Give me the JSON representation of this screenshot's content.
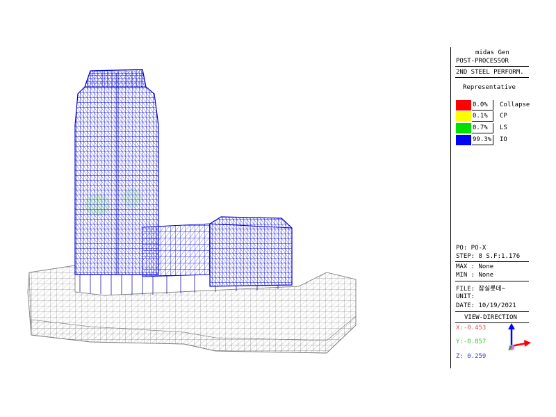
{
  "legend_panel": {
    "app_name": "midas Gen",
    "module": "POST-PROCESSOR",
    "result_type": "2ND STEEL PERFORM.",
    "mode": "Representative",
    "levels": [
      {
        "percent": "0.0%",
        "label": "Collapse",
        "color": "#ff0000"
      },
      {
        "percent": "0.1%",
        "label": "CP",
        "color": "#ffff00"
      },
      {
        "percent": "0.7%",
        "label": "LS",
        "color": "#00e000"
      },
      {
        "percent": "99.3%",
        "label": "IO",
        "color": "#0000ff"
      }
    ],
    "po": "PO: PO-X",
    "step": "STEP: 8 S.F:1.176",
    "max": "MAX : None",
    "min": "MIN : None",
    "file": "FILE: 잠실롯데~",
    "unit": "UNIT:",
    "date": "DATE: 10/19/2021",
    "view_direction_title": "VIEW-DIRECTION",
    "view_x": "X:-0.453",
    "view_y": "Y:-0.857",
    "view_z": "Z: 0.259",
    "colors": {
      "x": "#e05050",
      "y": "#40c040",
      "z": "#4040e0"
    }
  }
}
